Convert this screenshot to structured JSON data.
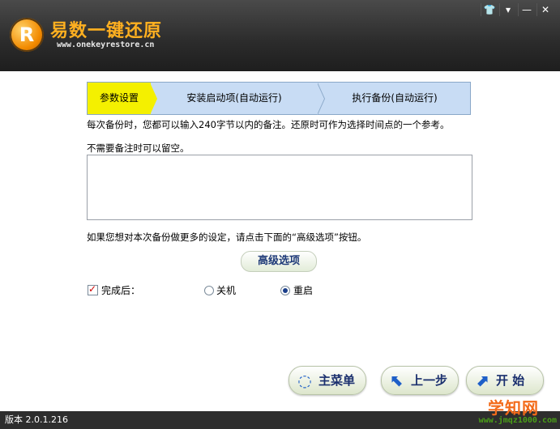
{
  "app": {
    "name": "易数一键还原",
    "url": "www.onekeyrestore.cn",
    "logo_text": "R"
  },
  "window_controls": [
    "shirt-icon",
    "menu-icon",
    "minimize-icon",
    "close-icon"
  ],
  "steps": [
    {
      "label": "参数设置",
      "active": true
    },
    {
      "label": "安装启动项(自动运行)",
      "active": false
    },
    {
      "label": "执行备份(自动运行)",
      "active": false
    }
  ],
  "notes": {
    "line1": "每次备份时，您都可以输入240字节以内的备注。还原时可作为选择时间点的一个参考。",
    "line2": "不需要备注时可以留空。",
    "line3": "如果您想对本次备份做更多的设定，请点击下面的“高级选项”按钮。"
  },
  "memo": {
    "value": ""
  },
  "advanced_button": "高级选项",
  "completion": {
    "label": "完成后：",
    "checked": true,
    "options": [
      {
        "label": "关机",
        "selected": false
      },
      {
        "label": "重启",
        "selected": true
      }
    ]
  },
  "buttons": {
    "main_menu": "主菜单",
    "previous": "上一步",
    "start": "开 始"
  },
  "status": {
    "version": "版本 2.0.1.216"
  },
  "watermark": {
    "big": "学知网",
    "small": "www.jmqz1000.com"
  },
  "colors": {
    "active_step": "#f4f000",
    "step_bg": "#c8dcf4",
    "button_text": "#1a2f6e"
  }
}
